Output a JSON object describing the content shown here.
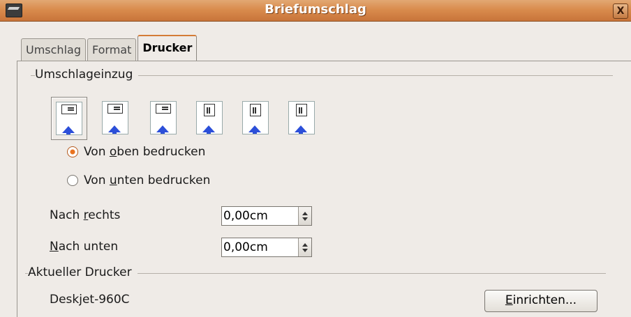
{
  "window": {
    "title": "Briefumschlag",
    "close_glyph": "X",
    "app_icon": "app-icon"
  },
  "tabs": [
    {
      "label": "Umschlag",
      "active": false
    },
    {
      "label": "Format",
      "active": false
    },
    {
      "label": "Drucker",
      "active": true
    }
  ],
  "feed": {
    "group_label": "Umschlageinzug",
    "options": [
      {
        "orientation": "horizontal",
        "selected": true
      },
      {
        "orientation": "horizontal",
        "selected": false
      },
      {
        "orientation": "horizontal",
        "selected": false
      },
      {
        "orientation": "vertical",
        "selected": false
      },
      {
        "orientation": "vertical",
        "selected": false
      },
      {
        "orientation": "vertical",
        "selected": false
      }
    ],
    "radio_top": {
      "pre": "Von ",
      "mnemonic": "o",
      "post": "ben bedrucken",
      "checked": true
    },
    "radio_bottom": {
      "pre": "Von ",
      "mnemonic": "u",
      "post": "nten bedrucken",
      "checked": false
    }
  },
  "offsets": {
    "right": {
      "pre": "Nach ",
      "mnemonic": "r",
      "post": "echts",
      "value": "0,00cm"
    },
    "down": {
      "pre": "",
      "mnemonic": "N",
      "post": "ach unten",
      "value": "0,00cm"
    }
  },
  "printer": {
    "group_label": "Aktueller Drucker",
    "name": "Deskjet-960C",
    "setup_button": {
      "mnemonic": "E",
      "post": "inrichten..."
    }
  },
  "colors": {
    "title_bar": "#d98c4d",
    "active_tab_accent": "#d47b36",
    "radio_checked": "#e9721e",
    "arrow": "#2c4fd9"
  }
}
